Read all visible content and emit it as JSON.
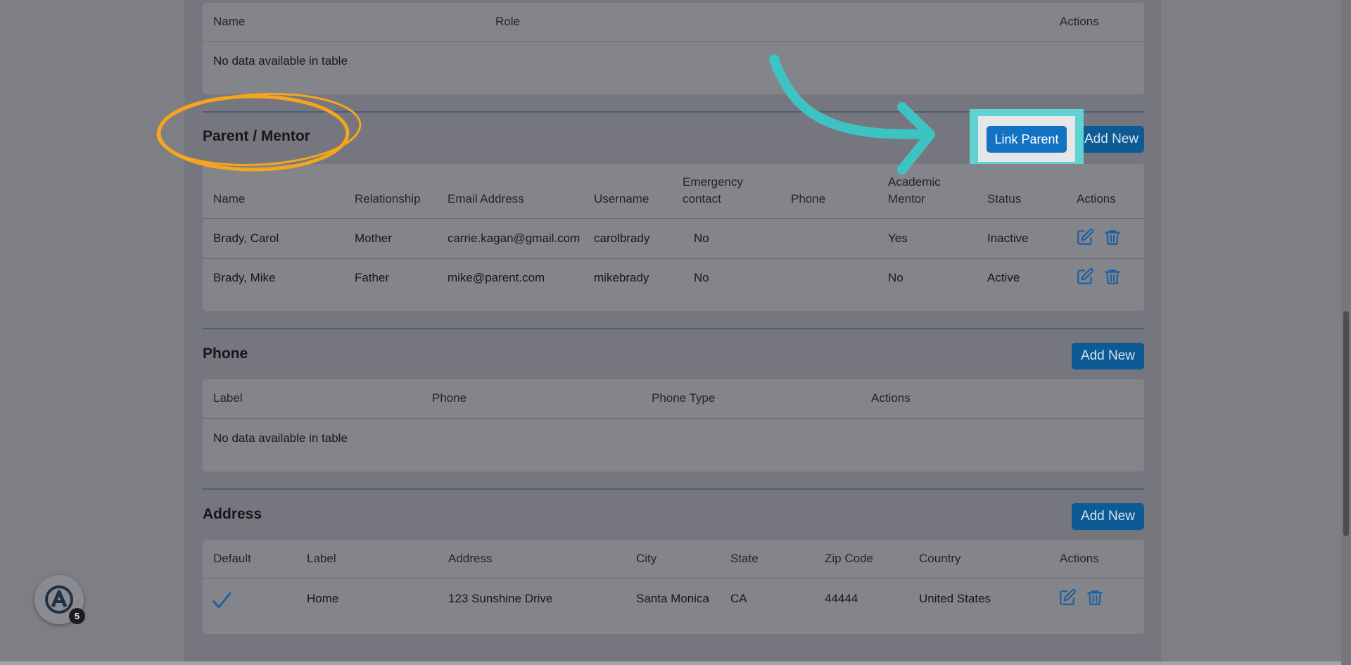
{
  "top_table": {
    "headers": [
      "Name",
      "Role",
      "Actions"
    ],
    "empty_message": "No data available in table"
  },
  "parent_section": {
    "title": "Parent / Mentor",
    "link_button": "Link Parent",
    "add_button": "Add New",
    "headers": {
      "name": "Name",
      "relationship": "Relationship",
      "email": "Email Address",
      "username": "Username",
      "emergency_line1": "Emergency",
      "emergency_line2": "contact",
      "phone": "Phone",
      "academic_line1": "Academic",
      "academic_line2": "Mentor",
      "status": "Status",
      "actions": "Actions"
    },
    "rows": [
      {
        "name": "Brady, Carol",
        "relationship": "Mother",
        "email": "carrie.kagan@gmail.com",
        "username": "carolbrady",
        "emergency": "No",
        "phone": "",
        "mentor": "Yes",
        "status": "Inactive"
      },
      {
        "name": "Brady, Mike",
        "relationship": "Father",
        "email": "mike@parent.com",
        "username": "mikebrady",
        "emergency": "No",
        "phone": "",
        "mentor": "No",
        "status": "Active"
      }
    ]
  },
  "phone_section": {
    "title": "Phone",
    "add_button": "Add New",
    "headers": [
      "Label",
      "Phone",
      "Phone Type",
      "Actions"
    ],
    "empty_message": "No data available in table"
  },
  "address_section": {
    "title": "Address",
    "add_button": "Add New",
    "headers": [
      "Default",
      "Label",
      "Address",
      "City",
      "State",
      "Zip Code",
      "Country",
      "Actions"
    ],
    "rows": [
      {
        "default_icon": "checkmark-icon",
        "label": "Home",
        "address": "123 Sunshine Drive",
        "city": "Santa Monica",
        "state": "CA",
        "zip": "44444",
        "country": "United States"
      }
    ]
  },
  "help_widget": {
    "badge_count": "5",
    "icon": "app-logo-icon"
  },
  "annotations": {
    "circle_color": "#f6a51c",
    "arrow_color": "#3ec3c3",
    "highlight_color": "#5fd2d2"
  },
  "colors": {
    "button": "#0d5a94",
    "link_button": "#1273c4",
    "icon": "#1c5fa3"
  }
}
